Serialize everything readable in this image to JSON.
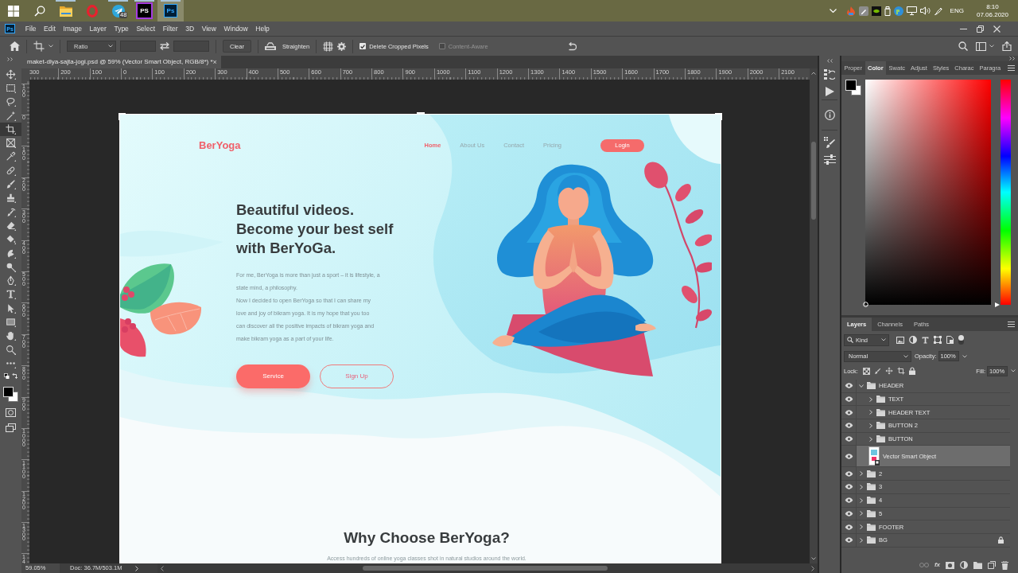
{
  "taskbar": {
    "apps": [
      {
        "kind": "folder",
        "running": true,
        "selected": false
      },
      {
        "kind": "opera",
        "running": false,
        "selected": false
      },
      {
        "kind": "telegram",
        "running": true,
        "selected": false,
        "badge": "48"
      },
      {
        "kind": "phpstorm",
        "running": true,
        "selected": false,
        "logo_text": "PS"
      },
      {
        "kind": "photoshop",
        "running": true,
        "selected": true,
        "logo_text": "Ps"
      }
    ],
    "language": "ENG",
    "time": "8:10",
    "date": "07.06.2020"
  },
  "menu_bar": {
    "logo_text": "Ps",
    "items": [
      "File",
      "Edit",
      "Image",
      "Layer",
      "Type",
      "Select",
      "Filter",
      "3D",
      "View",
      "Window",
      "Help"
    ]
  },
  "options_bar": {
    "ratio": "Ratio",
    "clear": "Clear",
    "straighten": "Straighten",
    "checkboxes": [
      {
        "label": "Delete Cropped Pixels",
        "checked": true,
        "disabled": false
      },
      {
        "label": "Content-Aware",
        "checked": false,
        "disabled": true
      }
    ]
  },
  "toolbar": {
    "tools": [
      {
        "kind": "move",
        "selected": false
      },
      {
        "kind": "marquee",
        "selected": false
      },
      {
        "kind": "lasso",
        "selected": false
      },
      {
        "kind": "wand",
        "selected": false
      },
      {
        "kind": "crop",
        "selected": true
      },
      {
        "kind": "frame",
        "selected": false
      },
      {
        "kind": "eyedropper",
        "selected": false
      },
      {
        "kind": "healing",
        "selected": false
      },
      {
        "kind": "brush",
        "selected": false
      },
      {
        "kind": "stamp",
        "selected": false
      },
      {
        "kind": "history",
        "selected": false
      },
      {
        "kind": "eraser",
        "selected": false
      },
      {
        "kind": "bucket",
        "selected": false
      },
      {
        "kind": "smudge",
        "selected": false
      },
      {
        "kind": "dodge",
        "selected": false
      },
      {
        "kind": "pen",
        "selected": false
      },
      {
        "kind": "type",
        "selected": false
      },
      {
        "kind": "pathsel",
        "selected": false
      },
      {
        "kind": "rect",
        "selected": false
      },
      {
        "kind": "hand",
        "selected": false
      },
      {
        "kind": "zoom",
        "selected": false
      },
      {
        "kind": "more",
        "selected": false
      }
    ]
  },
  "document": {
    "tab_title": "maket-dlya-sajta-jogi.psd @ 59% (Vector Smart Object, RGB/8*) *",
    "tab_close": "×"
  },
  "rulers": {
    "horizontal": [
      "300",
      "200",
      "100",
      "0",
      "100",
      "200",
      "300",
      "400",
      "500",
      "600",
      "700",
      "800",
      "900",
      "1000",
      "1100",
      "1200",
      "1300",
      "1400",
      "1500",
      "1600",
      "1700",
      "1800",
      "1900",
      "2000",
      "2100"
    ],
    "vertical": [
      "100",
      "0",
      "100",
      "200",
      "300",
      "400",
      "500",
      "600",
      "700",
      "800",
      "900",
      "1000",
      "1100",
      "1200",
      "1300",
      "14"
    ]
  },
  "design": {
    "logo": "BerYoga",
    "nav": [
      {
        "label": "Home",
        "selected": true
      },
      {
        "label": "About Us",
        "selected": false
      },
      {
        "label": "Contact",
        "selected": false
      },
      {
        "label": "Pricing",
        "selected": false
      }
    ],
    "login": "Login",
    "headline": [
      "Beautiful videos.",
      "Become your best self",
      "with BerYoGa."
    ],
    "paragraph": [
      "For me, BerYoga is more than just a sport – it is lifestyle, a",
      "state mind, a philosophy.",
      "Now I decided to open BerYoga so that I can share my",
      "love and joy of bikram yoga. It is my hope that you too",
      "can discover all the positive impacts of bikram yoga and",
      "make bikram yoga as a part of your life."
    ],
    "buttons": [
      {
        "label": "Service",
        "kind": "filled"
      },
      {
        "label": "Sign Up",
        "kind": "outline"
      }
    ],
    "section_title": "Why Choose BerYoga?",
    "section_text": "Access hundreds of online yoga classes shot in natural studios around the world."
  },
  "color_panel": {
    "tabs": [
      {
        "label": "Proper",
        "selected": false
      },
      {
        "label": "Color",
        "selected": true
      },
      {
        "label": "Swatc",
        "selected": false
      },
      {
        "label": "Adjust",
        "selected": false
      },
      {
        "label": "Styles",
        "selected": false
      },
      {
        "label": "Charac",
        "selected": false
      },
      {
        "label": "Paragra",
        "selected": false
      }
    ],
    "hue": {
      "level": 0
    }
  },
  "layers_panel": {
    "tabs": [
      {
        "label": "Layers",
        "selected": true
      },
      {
        "label": "Channels",
        "selected": false
      },
      {
        "label": "Paths",
        "selected": false
      }
    ],
    "filter": "Kind",
    "blend_mode": "Normal",
    "opacity_label": "Opacity:",
    "opacity": "100%",
    "lock_label": "Lock:",
    "fill_label": "Fill:",
    "fill": "100%",
    "layers": [
      {
        "name": "HEADER",
        "kind": "group",
        "visible": true,
        "expanded": true,
        "selected": false,
        "locked": false,
        "children": [
          {
            "name": "TEXT",
            "kind": "group",
            "visible": true,
            "expanded": false,
            "selected": false,
            "locked": false
          },
          {
            "name": "HEADER TEXT",
            "kind": "group",
            "visible": true,
            "expanded": false,
            "selected": false,
            "locked": false
          },
          {
            "name": "BUTTON 2",
            "kind": "group",
            "visible": true,
            "expanded": false,
            "selected": false,
            "locked": false
          },
          {
            "name": "BUTTON",
            "kind": "group",
            "visible": true,
            "expanded": false,
            "selected": false,
            "locked": false
          },
          {
            "name": "Vector Smart Object",
            "kind": "smart_object",
            "visible": true,
            "selected": true,
            "locked": false
          }
        ]
      },
      {
        "name": "2",
        "kind": "group",
        "visible": true,
        "expanded": false,
        "selected": false,
        "locked": false
      },
      {
        "name": "3",
        "kind": "group",
        "visible": true,
        "expanded": false,
        "selected": false,
        "locked": false
      },
      {
        "name": "4",
        "kind": "group",
        "visible": true,
        "expanded": false,
        "selected": false,
        "locked": false
      },
      {
        "name": "5",
        "kind": "group",
        "visible": true,
        "expanded": false,
        "selected": false,
        "locked": false
      },
      {
        "name": "FOOTER",
        "kind": "group",
        "visible": true,
        "expanded": false,
        "selected": false,
        "locked": false
      },
      {
        "name": "BG",
        "kind": "group",
        "visible": true,
        "expanded": false,
        "selected": false,
        "locked": true
      }
    ],
    "effects_button": "fx"
  },
  "status_bar": {
    "zoom": "59.05%",
    "doc": "Doc: 36.7M/503.1M"
  }
}
